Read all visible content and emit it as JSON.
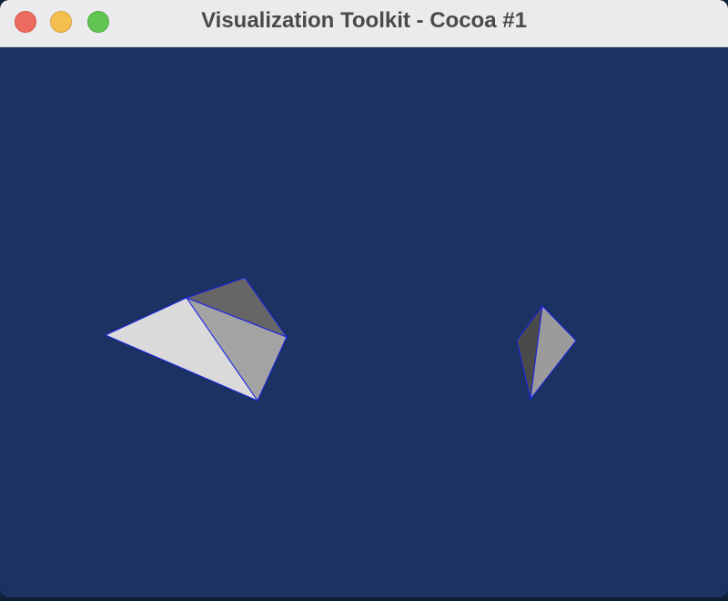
{
  "window": {
    "title": "Visualization Toolkit - Cocoa #1",
    "background_color": "#1b3262",
    "edge_color": "#1a22e8"
  },
  "titlebar": {
    "buttons": [
      {
        "name": "close-button",
        "color": "#ed6a5e"
      },
      {
        "name": "minimize-button",
        "color": "#f5bf4f"
      },
      {
        "name": "zoom-button",
        "color": "#61c554"
      }
    ]
  },
  "scene": {
    "objects": [
      {
        "name": "left-mesh",
        "face_colors": [
          "#dadada",
          "#a3a3a3",
          "#666666"
        ]
      },
      {
        "name": "right-mesh",
        "face_colors": [
          "#4a4a4a",
          "#9b9b9b"
        ]
      }
    ]
  }
}
